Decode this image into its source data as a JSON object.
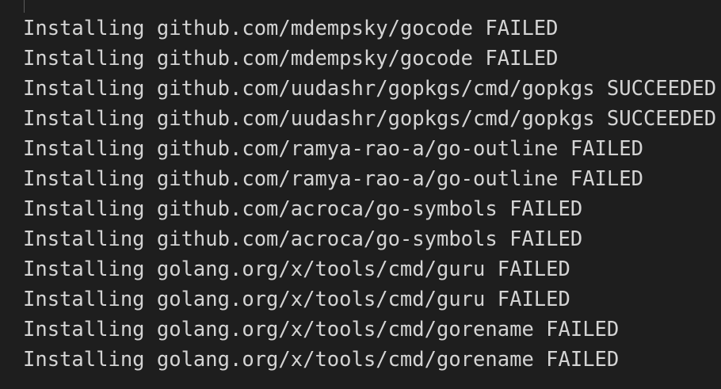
{
  "output": {
    "lines": [
      "Installing github.com/mdempsky/gocode FAILED",
      "Installing github.com/mdempsky/gocode FAILED",
      "Installing github.com/uudashr/gopkgs/cmd/gopkgs SUCCEEDED",
      "Installing github.com/uudashr/gopkgs/cmd/gopkgs SUCCEEDED",
      "Installing github.com/ramya-rao-a/go-outline FAILED",
      "Installing github.com/ramya-rao-a/go-outline FAILED",
      "Installing github.com/acroca/go-symbols FAILED",
      "Installing github.com/acroca/go-symbols FAILED",
      "Installing golang.org/x/tools/cmd/guru FAILED",
      "Installing golang.org/x/tools/cmd/guru FAILED",
      "Installing golang.org/x/tools/cmd/gorename FAILED",
      "Installing golang.org/x/tools/cmd/gorename FAILED"
    ]
  },
  "colors": {
    "background": "#1e1e1e",
    "text": "#d4d4d4"
  }
}
